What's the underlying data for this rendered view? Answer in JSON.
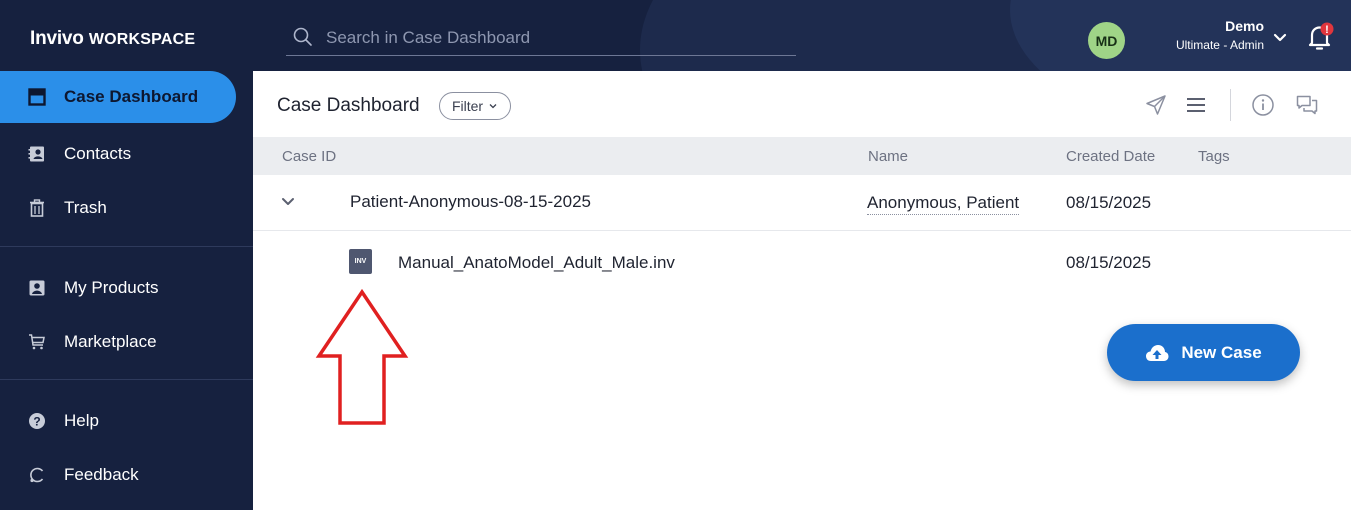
{
  "app": {
    "brand_main": "Invivo",
    "brand_sub": "WORKSPACE"
  },
  "search": {
    "placeholder": "Search in Case Dashboard",
    "icon": "search-icon"
  },
  "user": {
    "initials": "MD",
    "name": "Demo",
    "role": "Ultimate - Admin",
    "avatar_color": "#9fd487"
  },
  "notifications": {
    "icon": "bell-icon",
    "alert_badge": "!",
    "badge_color": "#e0363d"
  },
  "sidebar": {
    "items": [
      {
        "label": "Case Dashboard",
        "icon": "dashboard-icon",
        "active": true
      },
      {
        "label": "Contacts",
        "icon": "contacts-icon"
      },
      {
        "label": "Trash",
        "icon": "trash-icon"
      },
      {
        "label": "My Products",
        "icon": "products-icon"
      },
      {
        "label": "Marketplace",
        "icon": "cart-icon"
      },
      {
        "label": "Help",
        "icon": "help-icon"
      },
      {
        "label": "Feedback",
        "icon": "feedback-icon"
      }
    ],
    "active_color": "#2b8fe9",
    "background": "#16213f"
  },
  "main": {
    "title": "Case Dashboard",
    "filter_label": "Filter",
    "toolbar_icons": [
      "send-icon",
      "list-view-icon",
      "info-icon",
      "comments-icon"
    ]
  },
  "table": {
    "columns": [
      "Case ID",
      "Name",
      "Created Date",
      "Tags"
    ],
    "rows": [
      {
        "case_id": "Patient-Anonymous-08-15-2025",
        "name": "Anonymous, Patient",
        "created": "08/15/2025",
        "tags": "",
        "expanded": true
      },
      {
        "file": "Manual_AnatoModel_Adult_Male.inv",
        "file_badge": "INV",
        "created": "08/15/2025"
      }
    ]
  },
  "actions": {
    "new_case": "New Case",
    "new_case_color": "#1b6fcc"
  },
  "annotation": {
    "arrow_color": "#e02020"
  }
}
